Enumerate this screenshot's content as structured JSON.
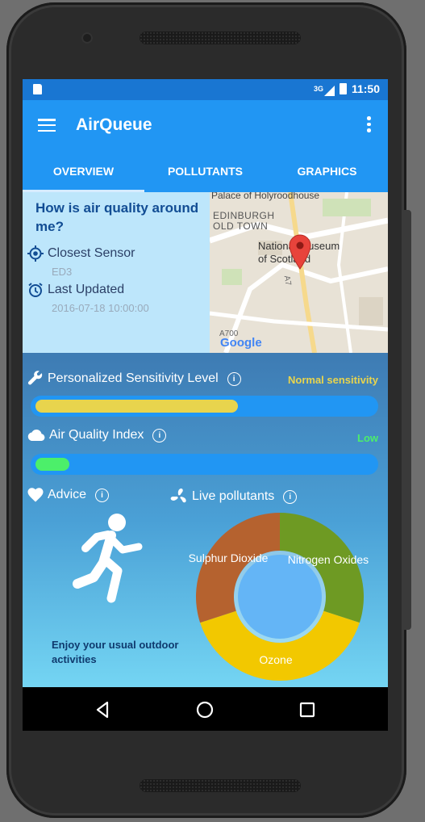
{
  "status_bar": {
    "network": "3G",
    "time": "11:50"
  },
  "app_bar": {
    "title": "AirQueue"
  },
  "tabs": [
    {
      "label": "OVERVIEW",
      "active": true
    },
    {
      "label": "POLLUTANTS",
      "active": false
    },
    {
      "label": "GRAPHICS",
      "active": false
    }
  ],
  "overview": {
    "question": "How is air quality around me?",
    "closest_sensor_label": "Closest Sensor",
    "closest_sensor_value": "ED3",
    "last_updated_label": "Last Updated",
    "last_updated_value": "2016-07-18 10:00:00"
  },
  "map": {
    "labels": [
      "Palace of Holyroodhouse",
      "EDINBURGH",
      "OLD TOWN",
      "National Museum",
      "of Scotland",
      "A7",
      "A700"
    ],
    "attribution": "Google"
  },
  "sensitivity": {
    "label": "Personalized Sensitivity Level",
    "level_text": "Normal sensitivity",
    "level_fraction": 0.6,
    "color": "#e8d44d"
  },
  "aqi": {
    "label": "Air Quality Index",
    "level_text": "Low",
    "level_fraction": 0.1,
    "color": "#4cef6a"
  },
  "advice": {
    "label": "Advice",
    "text": "Enjoy your usual outdoor activities"
  },
  "live_pollutants": {
    "label": "Live pollutants",
    "slices": [
      {
        "name": "Nitrogen Oxides",
        "value": 30,
        "color": "#6e9a23"
      },
      {
        "name": "Ozone",
        "value": 40,
        "color": "#f2c800"
      },
      {
        "name": "Sulphur Dioxide",
        "value": 30,
        "color": "#b5622f"
      }
    ]
  },
  "colors": {
    "status_bar": "#1976d2",
    "app_bar": "#2196f3",
    "overview_bg": "#bde6fb",
    "bar_track": "#2196f3"
  }
}
